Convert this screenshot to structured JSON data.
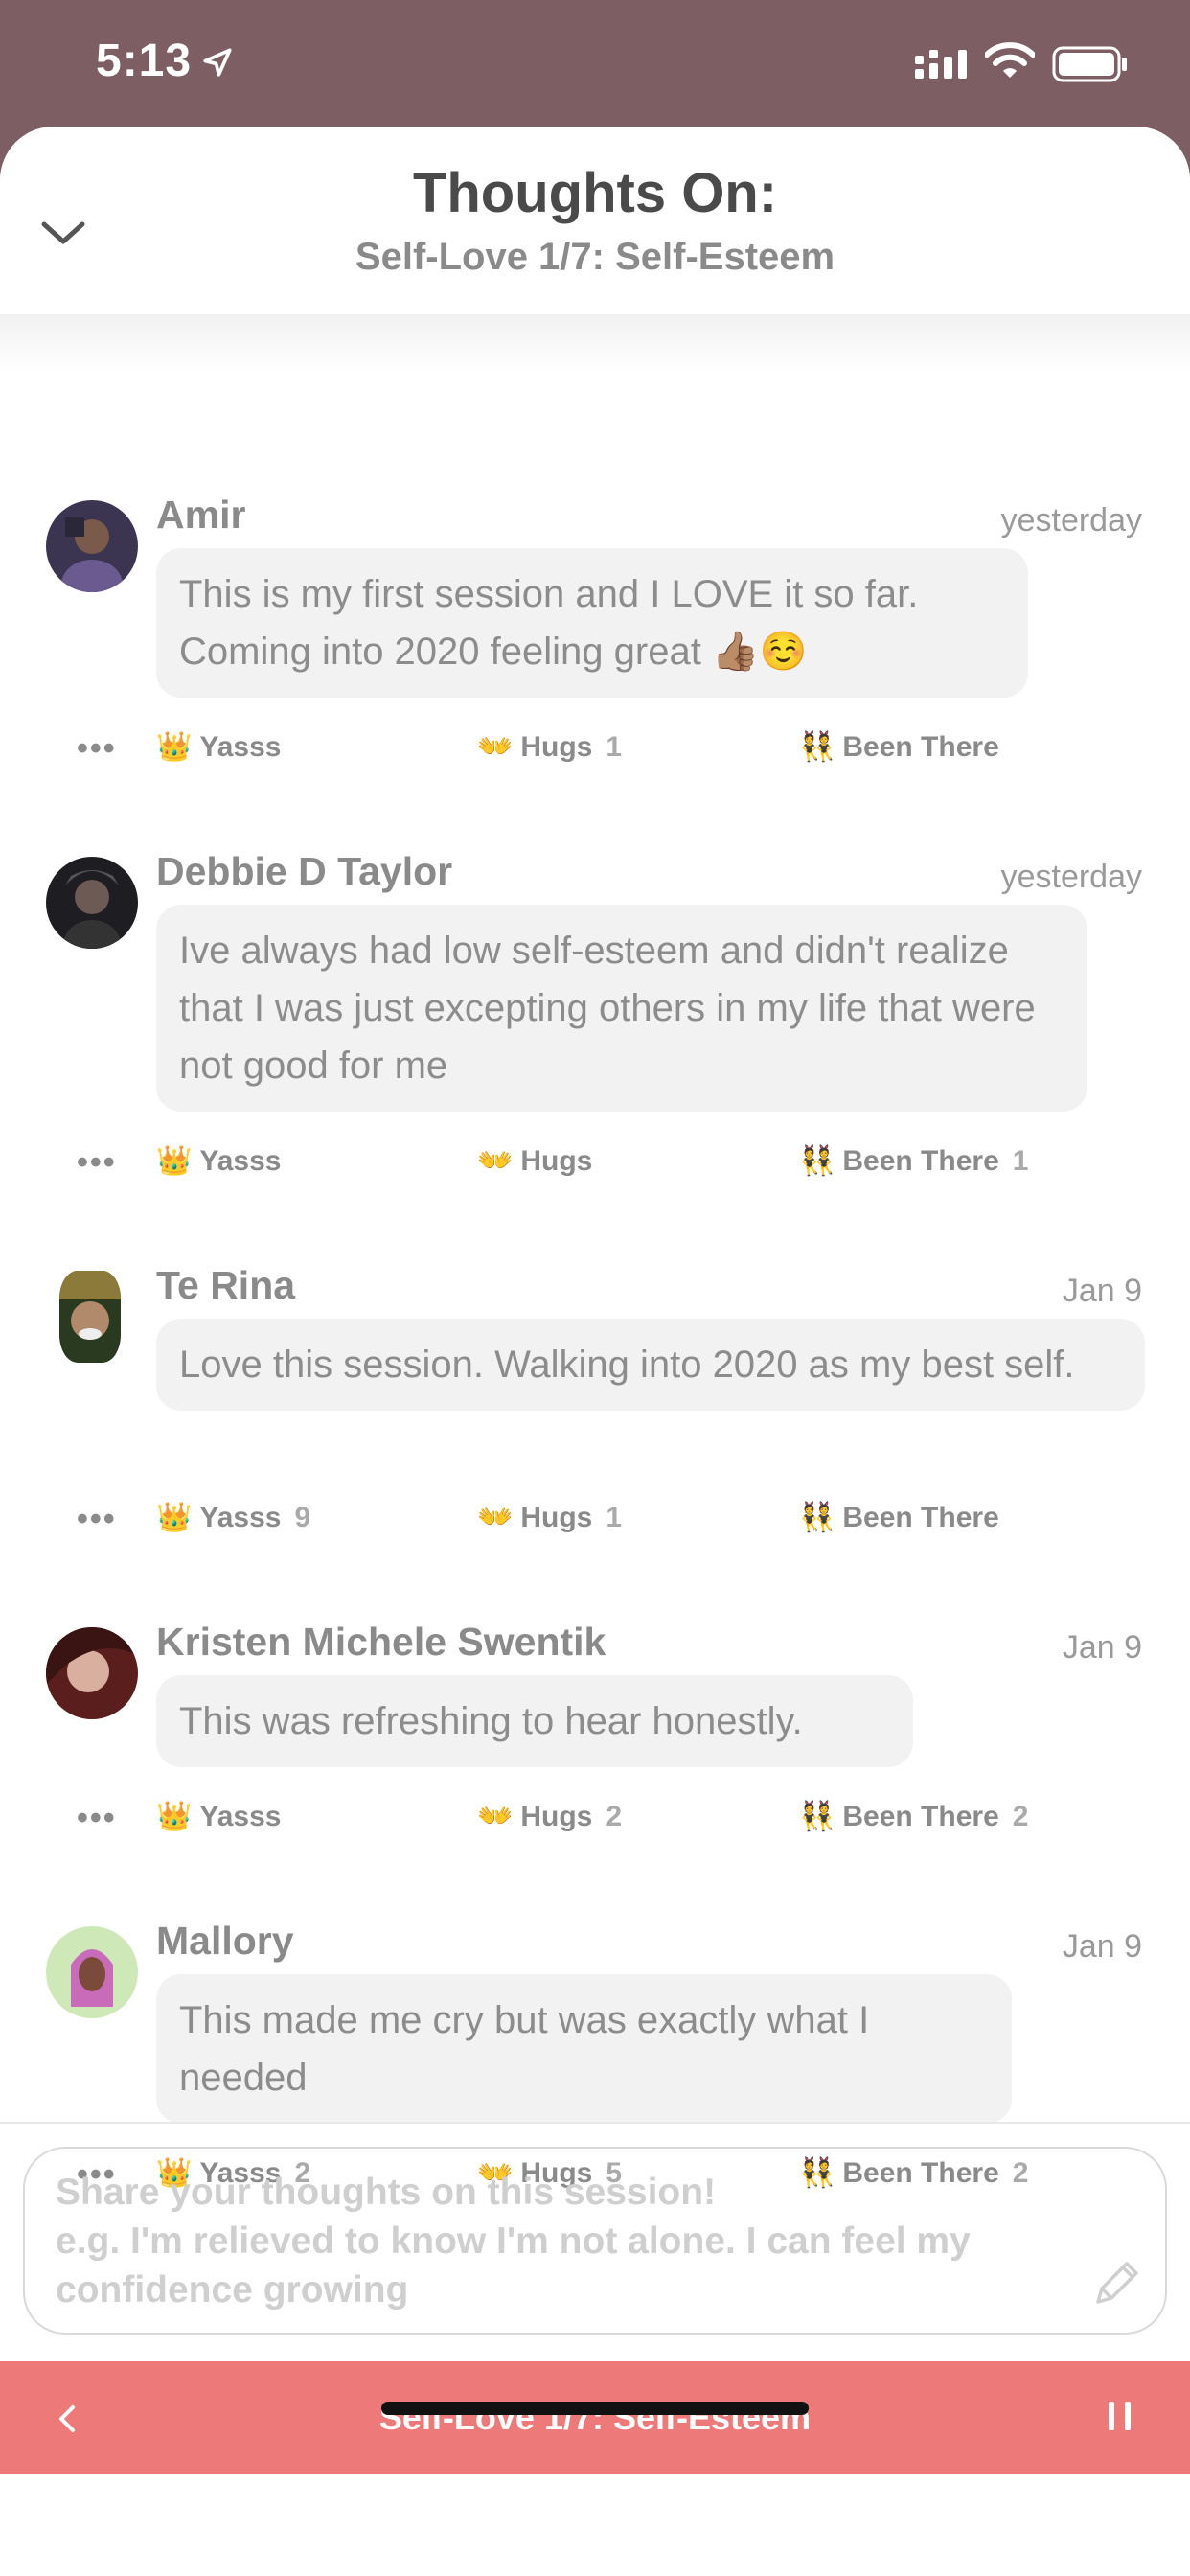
{
  "status_bar": {
    "time": "5:13"
  },
  "header": {
    "title": "Thoughts On:",
    "subtitle": "Self-Love 1/7: Self-Esteem"
  },
  "comments": [
    {
      "author": "Amir",
      "time": "yesterday",
      "text": "This is my first session and I LOVE it so far. Coming into 2020 feeling great 👍🏽☺️",
      "reactions": [
        {
          "emoji": "👑",
          "label": "Yasss",
          "count": ""
        },
        {
          "emoji": "👐",
          "label": "Hugs",
          "count": "1"
        },
        {
          "emoji": "👯",
          "label": "Been There",
          "count": ""
        }
      ]
    },
    {
      "author": "Debbie D Taylor",
      "time": "yesterday",
      "text": "Ive always had low self-esteem and didn't realize that I was just excepting others in my life that were not good for me",
      "reactions": [
        {
          "emoji": "👑",
          "label": "Yasss",
          "count": ""
        },
        {
          "emoji": "👐",
          "label": "Hugs",
          "count": ""
        },
        {
          "emoji": "👯",
          "label": "Been There",
          "count": "1"
        }
      ]
    },
    {
      "author": "Te Rina",
      "time": "Jan 9",
      "text": "Love this session. Walking into 2020 as my best self.",
      "reactions": [
        {
          "emoji": "👑",
          "label": "Yasss",
          "count": "9"
        },
        {
          "emoji": "👐",
          "label": "Hugs",
          "count": "1"
        },
        {
          "emoji": "👯",
          "label": "Been There",
          "count": ""
        }
      ]
    },
    {
      "author": "Kristen Michele Swentik",
      "time": "Jan 9",
      "text": "This was refreshing to hear honestly.",
      "reactions": [
        {
          "emoji": "👑",
          "label": "Yasss",
          "count": ""
        },
        {
          "emoji": "👐",
          "label": "Hugs",
          "count": "2"
        },
        {
          "emoji": "👯",
          "label": "Been There",
          "count": "2"
        }
      ]
    },
    {
      "author": "Mallory",
      "time": "Jan 9",
      "text": "This made me cry but was exactly what I needed",
      "reactions": [
        {
          "emoji": "👑",
          "label": "Yasss",
          "count": "2"
        },
        {
          "emoji": "👐",
          "label": "Hugs",
          "count": "5"
        },
        {
          "emoji": "👯",
          "label": "Been There",
          "count": "2"
        }
      ]
    }
  ],
  "more_label": "•••",
  "input": {
    "placeholder_line1": "Share your thoughts on this session!",
    "placeholder_line2": "e.g. I'm relieved to know I'm not alone. I can feel my confidence growing"
  },
  "player": {
    "title": "Self-Love 1/7: Self-Esteem"
  },
  "colors": {
    "player_bg": "#ee7979",
    "status_bg": "#7d5f63"
  },
  "icons": [
    "location-arrow-icon",
    "signal-icon",
    "wifi-icon",
    "battery-icon",
    "chevron-down-icon",
    "pencil-icon",
    "back-icon",
    "pause-icon",
    "more-icon",
    "crown-icon",
    "hugs-icon",
    "been-there-icon"
  ]
}
